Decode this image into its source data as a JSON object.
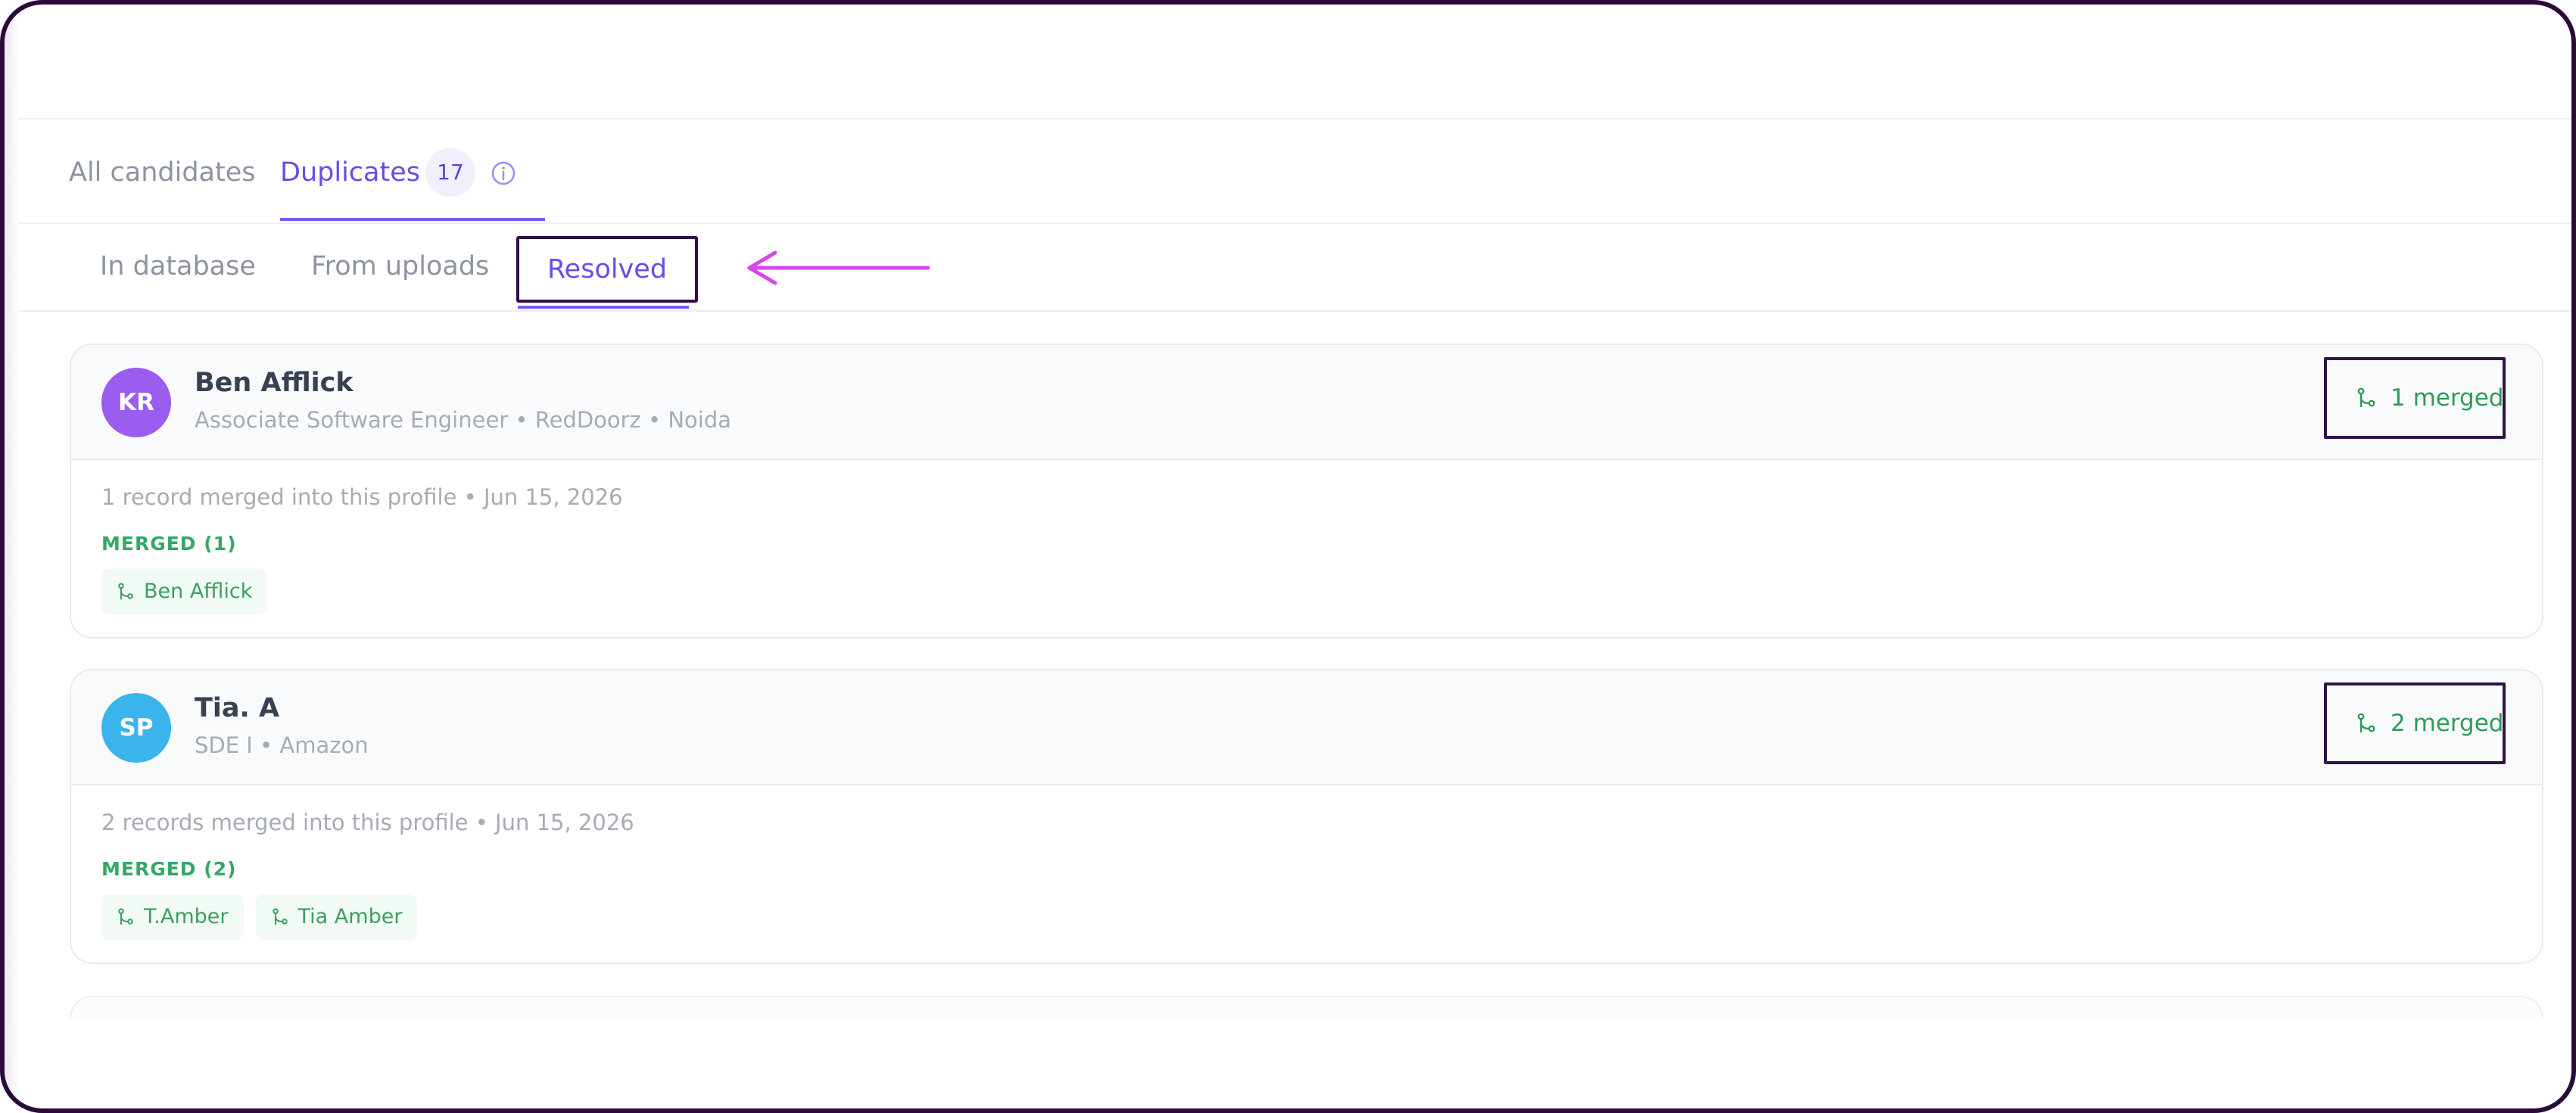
{
  "tabs": {
    "all_candidates": "All candidates",
    "duplicates": "Duplicates",
    "duplicates_count": "17"
  },
  "subtabs": {
    "in_database": "In database",
    "from_uploads": "From uploads",
    "resolved": "Resolved"
  },
  "colors": {
    "accent": "#6a4bea",
    "merged_green": "#34a866",
    "annotation_arrow": "#d946ef"
  },
  "candidates": [
    {
      "initials": "KR",
      "avatar_color": "#9b5cf0",
      "name": "Ben Afflick",
      "subtitle": "Associate Software Engineer • RedDoorz • Noida",
      "badge": "1 merged",
      "record_line": "1 record merged into this profile • Jun 15, 2026",
      "merged_heading": "MERGED (1)",
      "merged_items": [
        "Ben Afflick"
      ]
    },
    {
      "initials": "SP",
      "avatar_color": "#3ab4ea",
      "name": "Tia. A",
      "subtitle": "SDE I • Amazon",
      "badge": "2 merged",
      "record_line": "2 records merged into this profile • Jun 15, 2026",
      "merged_heading": "MERGED (2)",
      "merged_items": [
        "T.Amber",
        "Tia Amber"
      ]
    }
  ],
  "icons": {
    "merge": "merge-icon",
    "info": "info-icon",
    "arrow": "arrow-left-icon"
  }
}
